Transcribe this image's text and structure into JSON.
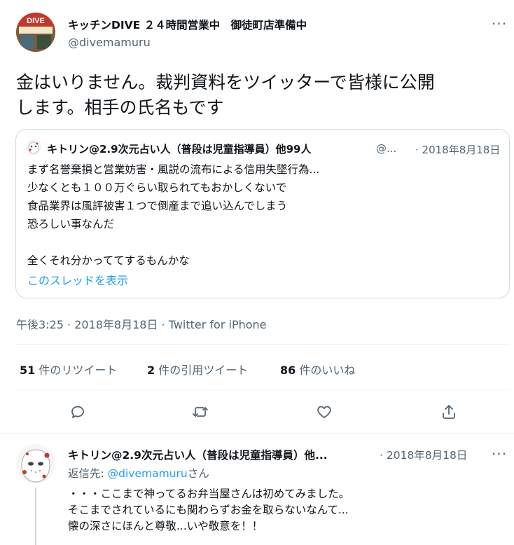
{
  "tweet": {
    "author_name": "キッチンDIVE ２４時間営業中　御徒町店準備中",
    "author_handle": "@divemamuru",
    "avatar_label": "DIVE",
    "text_line1": "金はいりません。裁判資料をツイッターで皆様に公開",
    "text_line2": "します。相手の氏名もです",
    "timestamp": "午後3:25 · 2018年8月18日 · Twitter for iPhone"
  },
  "quote": {
    "author_name": "キトリン@2.9次元占い人（普段は児童指導員）他99人",
    "author_handle": "@...",
    "date": "· 2018年8月18日",
    "lines": [
      "まず名誉棄損と営業妨害・風説の流布による信用失墜行為...",
      "少なくとも１００万ぐらい取られてもおかしくないで",
      "食品業界は風評被害１つで倒産まで追い込んでしまう",
      "恐ろしい事なんだ",
      "",
      "全くそれ分かっててするもんかな"
    ],
    "thread_link": "このスレッドを表示"
  },
  "stats": {
    "retweets_num": "51",
    "retweets_label": " 件のリツイート",
    "quotes_num": "2",
    "quotes_label": " 件の引用ツイート",
    "likes_num": "86",
    "likes_label": " 件のいいね"
  },
  "actions": [
    "reply-icon",
    "retweet-icon",
    "like-icon",
    "share-icon"
  ],
  "reply": {
    "author_name": "キトリン@2.9次元占い人（普段は児童指導員）他...",
    "date": "· 2018年8月18日",
    "reply_to_prefix": "返信先: ",
    "reply_to_handle": "@divemamuru",
    "reply_to_suffix": "さん",
    "lines": [
      "・・・ここまで神ってるお弁当屋さんは初めてみました。",
      "そこまでされているにも関わらずお金を取らないなんて...",
      "懐の深さにほんと尊敬...いや敬意を！！"
    ]
  },
  "more_label": "···",
  "colors": {
    "accent": "#1d9bf0",
    "muted": "#536471",
    "border": "#cfd9de"
  }
}
